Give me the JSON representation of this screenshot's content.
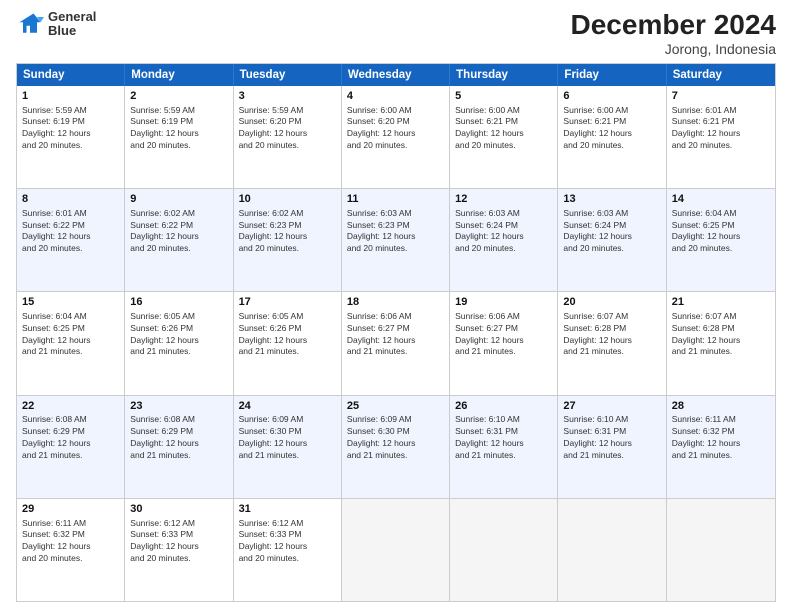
{
  "header": {
    "logo_line1": "General",
    "logo_line2": "Blue",
    "title": "December 2024",
    "subtitle": "Jorong, Indonesia"
  },
  "days_of_week": [
    "Sunday",
    "Monday",
    "Tuesday",
    "Wednesday",
    "Thursday",
    "Friday",
    "Saturday"
  ],
  "weeks": [
    [
      {
        "day": "1",
        "info": "Sunrise: 5:59 AM\nSunset: 6:19 PM\nDaylight: 12 hours\nand 20 minutes."
      },
      {
        "day": "2",
        "info": "Sunrise: 5:59 AM\nSunset: 6:19 PM\nDaylight: 12 hours\nand 20 minutes."
      },
      {
        "day": "3",
        "info": "Sunrise: 5:59 AM\nSunset: 6:20 PM\nDaylight: 12 hours\nand 20 minutes."
      },
      {
        "day": "4",
        "info": "Sunrise: 6:00 AM\nSunset: 6:20 PM\nDaylight: 12 hours\nand 20 minutes."
      },
      {
        "day": "5",
        "info": "Sunrise: 6:00 AM\nSunset: 6:21 PM\nDaylight: 12 hours\nand 20 minutes."
      },
      {
        "day": "6",
        "info": "Sunrise: 6:00 AM\nSunset: 6:21 PM\nDaylight: 12 hours\nand 20 minutes."
      },
      {
        "day": "7",
        "info": "Sunrise: 6:01 AM\nSunset: 6:21 PM\nDaylight: 12 hours\nand 20 minutes."
      }
    ],
    [
      {
        "day": "8",
        "info": "Sunrise: 6:01 AM\nSunset: 6:22 PM\nDaylight: 12 hours\nand 20 minutes."
      },
      {
        "day": "9",
        "info": "Sunrise: 6:02 AM\nSunset: 6:22 PM\nDaylight: 12 hours\nand 20 minutes."
      },
      {
        "day": "10",
        "info": "Sunrise: 6:02 AM\nSunset: 6:23 PM\nDaylight: 12 hours\nand 20 minutes."
      },
      {
        "day": "11",
        "info": "Sunrise: 6:03 AM\nSunset: 6:23 PM\nDaylight: 12 hours\nand 20 minutes."
      },
      {
        "day": "12",
        "info": "Sunrise: 6:03 AM\nSunset: 6:24 PM\nDaylight: 12 hours\nand 20 minutes."
      },
      {
        "day": "13",
        "info": "Sunrise: 6:03 AM\nSunset: 6:24 PM\nDaylight: 12 hours\nand 20 minutes."
      },
      {
        "day": "14",
        "info": "Sunrise: 6:04 AM\nSunset: 6:25 PM\nDaylight: 12 hours\nand 20 minutes."
      }
    ],
    [
      {
        "day": "15",
        "info": "Sunrise: 6:04 AM\nSunset: 6:25 PM\nDaylight: 12 hours\nand 21 minutes."
      },
      {
        "day": "16",
        "info": "Sunrise: 6:05 AM\nSunset: 6:26 PM\nDaylight: 12 hours\nand 21 minutes."
      },
      {
        "day": "17",
        "info": "Sunrise: 6:05 AM\nSunset: 6:26 PM\nDaylight: 12 hours\nand 21 minutes."
      },
      {
        "day": "18",
        "info": "Sunrise: 6:06 AM\nSunset: 6:27 PM\nDaylight: 12 hours\nand 21 minutes."
      },
      {
        "day": "19",
        "info": "Sunrise: 6:06 AM\nSunset: 6:27 PM\nDaylight: 12 hours\nand 21 minutes."
      },
      {
        "day": "20",
        "info": "Sunrise: 6:07 AM\nSunset: 6:28 PM\nDaylight: 12 hours\nand 21 minutes."
      },
      {
        "day": "21",
        "info": "Sunrise: 6:07 AM\nSunset: 6:28 PM\nDaylight: 12 hours\nand 21 minutes."
      }
    ],
    [
      {
        "day": "22",
        "info": "Sunrise: 6:08 AM\nSunset: 6:29 PM\nDaylight: 12 hours\nand 21 minutes."
      },
      {
        "day": "23",
        "info": "Sunrise: 6:08 AM\nSunset: 6:29 PM\nDaylight: 12 hours\nand 21 minutes."
      },
      {
        "day": "24",
        "info": "Sunrise: 6:09 AM\nSunset: 6:30 PM\nDaylight: 12 hours\nand 21 minutes."
      },
      {
        "day": "25",
        "info": "Sunrise: 6:09 AM\nSunset: 6:30 PM\nDaylight: 12 hours\nand 21 minutes."
      },
      {
        "day": "26",
        "info": "Sunrise: 6:10 AM\nSunset: 6:31 PM\nDaylight: 12 hours\nand 21 minutes."
      },
      {
        "day": "27",
        "info": "Sunrise: 6:10 AM\nSunset: 6:31 PM\nDaylight: 12 hours\nand 21 minutes."
      },
      {
        "day": "28",
        "info": "Sunrise: 6:11 AM\nSunset: 6:32 PM\nDaylight: 12 hours\nand 21 minutes."
      }
    ],
    [
      {
        "day": "29",
        "info": "Sunrise: 6:11 AM\nSunset: 6:32 PM\nDaylight: 12 hours\nand 20 minutes."
      },
      {
        "day": "30",
        "info": "Sunrise: 6:12 AM\nSunset: 6:33 PM\nDaylight: 12 hours\nand 20 minutes."
      },
      {
        "day": "31",
        "info": "Sunrise: 6:12 AM\nSunset: 6:33 PM\nDaylight: 12 hours\nand 20 minutes."
      },
      {
        "day": "",
        "info": ""
      },
      {
        "day": "",
        "info": ""
      },
      {
        "day": "",
        "info": ""
      },
      {
        "day": "",
        "info": ""
      }
    ]
  ]
}
